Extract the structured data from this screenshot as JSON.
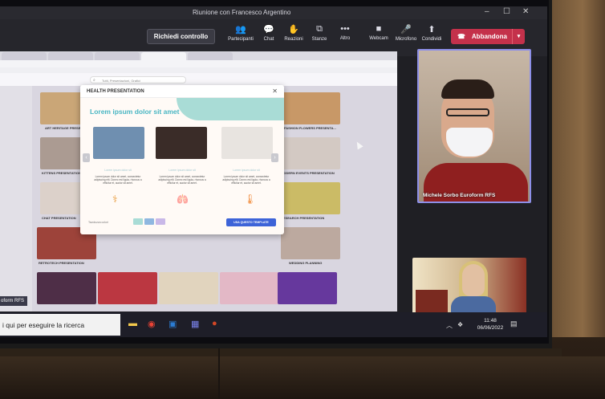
{
  "window": {
    "title": "Riunione con Francesco Argentino",
    "controls": [
      "–",
      "☐",
      "✕"
    ]
  },
  "toolbar": {
    "request_control": "Richiedi controllo",
    "items": [
      {
        "label": "Partecipanti",
        "icon": "people-icon",
        "glyph": "👥"
      },
      {
        "label": "Chat",
        "icon": "chat-icon",
        "glyph": "💬"
      },
      {
        "label": "Reazioni",
        "icon": "reactions-icon",
        "glyph": "✋"
      },
      {
        "label": "Stanze",
        "icon": "rooms-icon",
        "glyph": "⧉"
      },
      {
        "label": "Altro",
        "icon": "more-icon",
        "glyph": "•••"
      },
      {
        "label": "Webcam",
        "icon": "camera-icon",
        "glyph": "■"
      },
      {
        "label": "Microfono",
        "icon": "microphone-icon",
        "glyph": "🎤"
      },
      {
        "label": "Condividi",
        "icon": "share-icon",
        "glyph": "⬆"
      }
    ],
    "leave": "Abbandona"
  },
  "shared_screen": {
    "search_placeholder": "Tutti, Presentazioni, Grafici",
    "cards": [
      {
        "label": "ART HERITAGE PRESENTATION",
        "color": "#d8b27c"
      },
      {
        "label": "",
        "color": "#b93b2f"
      },
      {
        "label": "",
        "color": "#e8c8a0"
      },
      {
        "label": "",
        "color": "#7c4d8e"
      },
      {
        "label": "FASHION FLOWERS PRESENTA...",
        "color": "#d6a36b"
      },
      {
        "label": "KITTENS PRESENTATION",
        "color": "#b7a79a"
      },
      {
        "label": "MODERN EVENTS PRESENTATION",
        "color": "#e2d8cf"
      },
      {
        "label": "CHAT PRESENTATION",
        "color": "#ece1d6"
      },
      {
        "label": "RESEARCH PRESENTATION",
        "color": "#d9c96a"
      },
      {
        "label": "RETROTECH PRESENTATION",
        "color": "#a8473a"
      },
      {
        "label": "WEDDING PLANNING",
        "color": "#c9b6a8"
      },
      {
        "label": "",
        "color": "#523048"
      },
      {
        "label": "",
        "color": "#c83a42"
      },
      {
        "label": "",
        "color": "#f1e4c9"
      },
      {
        "label": "",
        "color": "#f4c6d2"
      },
      {
        "label": "",
        "color": "#6c3ba5"
      }
    ]
  },
  "modal": {
    "title": "HEALTH PRESENTATION",
    "headline": "Lorem ipsum dolor sit amet",
    "columns": [
      {
        "heading": "Lorem ipsum dolor sit",
        "text": "Lorem ipsum dolor sit amet, consectetur adipiscing elit. Donec est ligula, rhoncus a efficitur et, auctor sit amet.",
        "icon": "⚕",
        "photo": "#6f8fb0"
      },
      {
        "heading": "Lorem ipsum dolor sit",
        "text": "Lorem ipsum dolor sit amet, consectetur adipiscing elit. Donec est ligula, rhoncus a efficitur et, auctor sit amet.",
        "icon": "🫁",
        "photo": "#3a2c28"
      },
      {
        "heading": "Lorem ipsum dolor sit",
        "text": "Lorem ipsum dolor sit amet, consectetur adipiscing elit. Donec est ligula, rhoncus a efficitur et, auctor sit amet.",
        "icon": "🌡",
        "photo": "#e8e4e0"
      }
    ],
    "footer_label": "Tavolozza colori",
    "swatches": [
      "#a9dcd6",
      "#8fb7e0",
      "#c9b8e8"
    ],
    "use_template": "USA QUESTO TEMPLATE"
  },
  "participants": {
    "main_name": "Michele Sorbo Euroform RFS",
    "left_name": "oform RFS"
  },
  "taskbar": {
    "search_text": "i qui per eseguire la ricerca",
    "time": "11:48",
    "date": "06/06/2022"
  }
}
